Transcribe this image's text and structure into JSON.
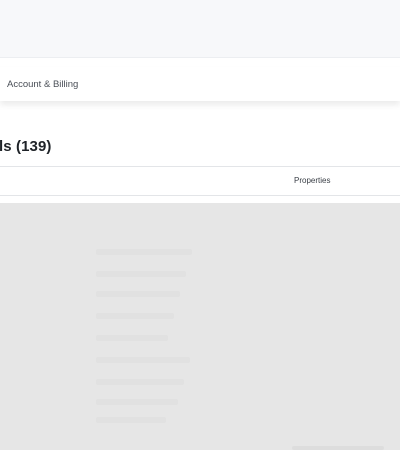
{
  "nav": {
    "account_billing": "Account & Billing"
  },
  "page": {
    "title": "ls (139)"
  },
  "table": {
    "columns": {
      "properties": "Properties"
    }
  }
}
